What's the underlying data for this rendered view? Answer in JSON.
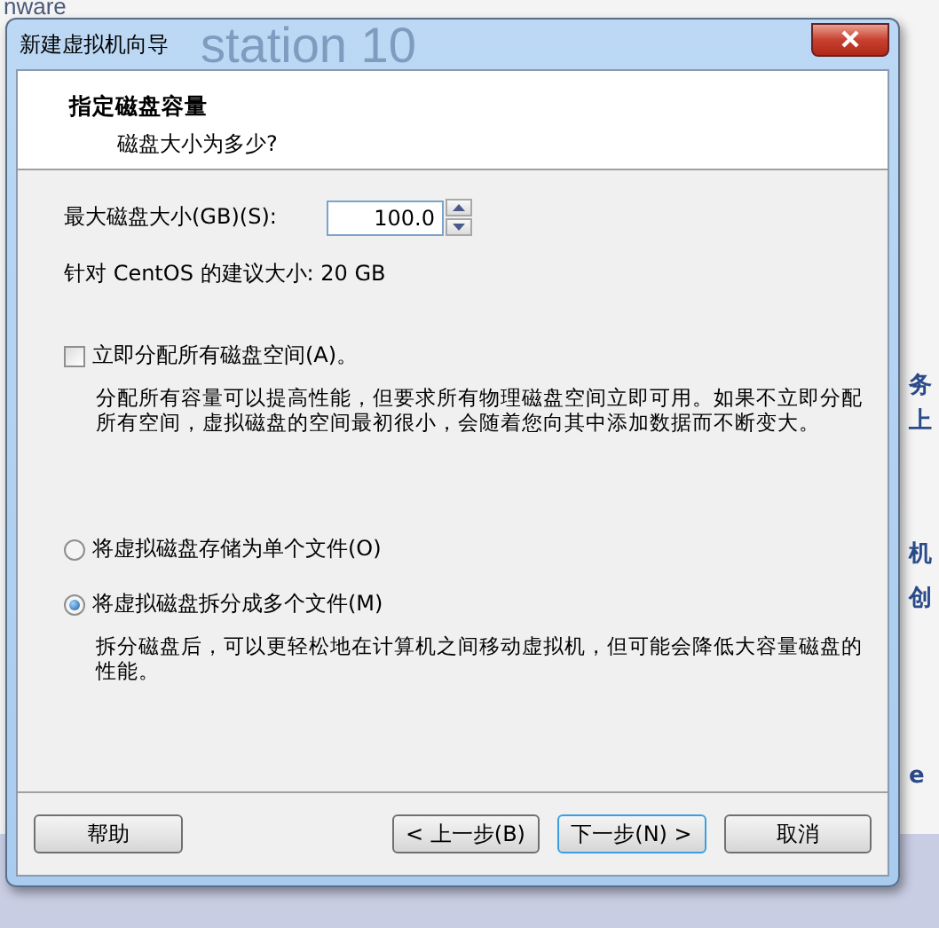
{
  "background": {
    "logo": "nware",
    "glass_text": "station 10",
    "side_texts": [
      "务",
      "上",
      "机",
      "创",
      "e"
    ]
  },
  "window": {
    "title": "新建虚拟机向导"
  },
  "header": {
    "title": "指定磁盘容量",
    "subtitle": "磁盘大小为多少?"
  },
  "disk_size": {
    "label": "最大磁盘大小(GB)(S):",
    "value": "100.0"
  },
  "recommendation": "针对 CentOS 的建议大小: 20 GB",
  "allocate": {
    "label": "立即分配所有磁盘空间(A)。",
    "checked": false,
    "description": "分配所有容量可以提高性能，但要求所有物理磁盘空间立即可用。如果不立即分配所有空间，虚拟磁盘的空间最初很小，会随着您向其中添加数据而不断变大。"
  },
  "storage_options": [
    {
      "label": "将虚拟磁盘存储为单个文件(O)",
      "selected": false
    },
    {
      "label": "将虚拟磁盘拆分成多个文件(M)",
      "selected": true,
      "description": "拆分磁盘后，可以更轻松地在计算机之间移动虚拟机，但可能会降低大容量磁盘的性能。"
    }
  ],
  "buttons": [
    {
      "label": "帮助",
      "focused": false,
      "kind": "help"
    },
    {
      "label": "< 上一步(B)",
      "focused": false,
      "kind": "nav"
    },
    {
      "label": "下一步(N) >",
      "focused": true,
      "kind": "nav"
    },
    {
      "label": "取消",
      "focused": false,
      "kind": "nav"
    }
  ]
}
